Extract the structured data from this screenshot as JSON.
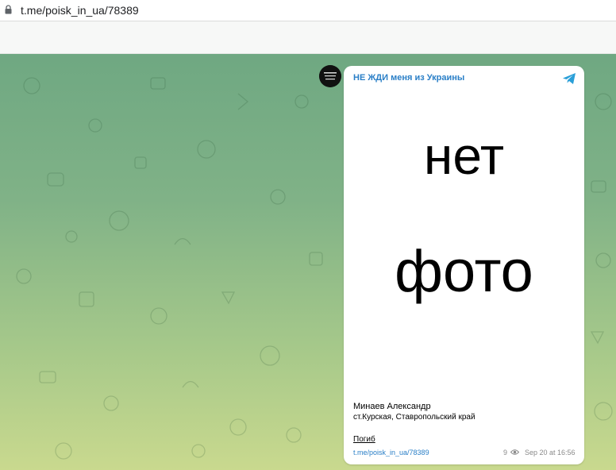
{
  "browser": {
    "url": "t.me/poisk_in_ua/78389"
  },
  "message": {
    "channel_name": "НЕ ЖДИ меня из Украины",
    "photo_line1": "нет",
    "photo_line2": "фото",
    "person_name": "Минаев Александр",
    "place": "ст.Курская, Ставропольский край",
    "status": "Погиб",
    "post_link": "t.me/poisk_in_ua/78389",
    "views": "9",
    "date": "Sep 20 at 16:56"
  },
  "colors": {
    "link": "#2a7fc7",
    "chat_bg_top": "#6fa882",
    "chat_bg_bottom": "#c9d98e"
  }
}
